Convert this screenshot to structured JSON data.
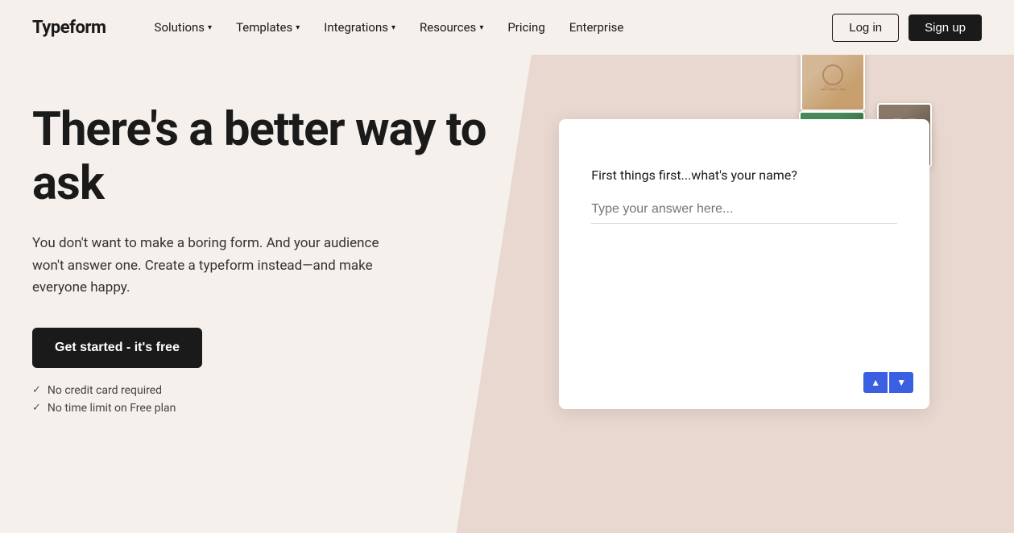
{
  "brand": {
    "name": "Typeform"
  },
  "nav": {
    "links": [
      {
        "label": "Solutions",
        "has_dropdown": true
      },
      {
        "label": "Templates",
        "has_dropdown": true
      },
      {
        "label": "Integrations",
        "has_dropdown": true
      },
      {
        "label": "Resources",
        "has_dropdown": true
      },
      {
        "label": "Pricing",
        "has_dropdown": false
      },
      {
        "label": "Enterprise",
        "has_dropdown": false
      }
    ],
    "login_label": "Log in",
    "signup_label": "Sign up"
  },
  "hero": {
    "title": "There's a better way to ask",
    "subtitle": "You don't want to make a boring form. And your audience won't answer one. Create a typeform instead—and make everyone happy.",
    "cta_label": "Get started - it's free",
    "perks": [
      "No credit card required",
      "No time limit on Free plan"
    ]
  },
  "form_preview": {
    "question": "First things first...what's your name?",
    "placeholder": "Type your answer here...",
    "arrow_up": "▲",
    "arrow_down": "▼"
  }
}
